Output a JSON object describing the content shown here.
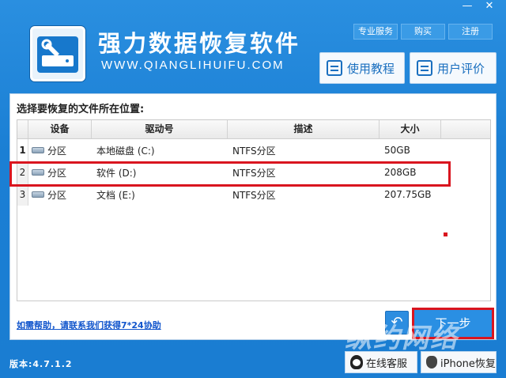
{
  "window": {
    "minimize": "—",
    "close": "✕"
  },
  "header": {
    "title": "强力数据恢复软件",
    "url": "WWW.QIANGLIHUIFU.COM",
    "links": [
      "专业服务",
      "购买",
      "注册"
    ],
    "tutorial_btn": "使用教程",
    "review_btn": "用户评价"
  },
  "panel": {
    "title": "选择要恢复的文件所在位置:",
    "columns": [
      "设备",
      "驱动号",
      "描述",
      "大小"
    ],
    "rows": [
      {
        "index": "1",
        "device": "分区",
        "drive": "本地磁盘 (C:)",
        "desc": "NTFS分区",
        "size": "50GB"
      },
      {
        "index": "2",
        "device": "分区",
        "drive": "软件 (D:)",
        "desc": "NTFS分区",
        "size": "208GB"
      },
      {
        "index": "3",
        "device": "分区",
        "drive": "文档 (E:)",
        "desc": "NTFS分区",
        "size": "207.75GB"
      }
    ],
    "help_link": "如需帮助，请联系我们获得7*24协助",
    "back_btn": "↶",
    "next_btn": "下一步"
  },
  "footer": {
    "version": "版本:4.7.1.2",
    "online_service": "在线客服",
    "iphone_recovery": "iPhone恢复"
  },
  "watermark": "纵约网络"
}
